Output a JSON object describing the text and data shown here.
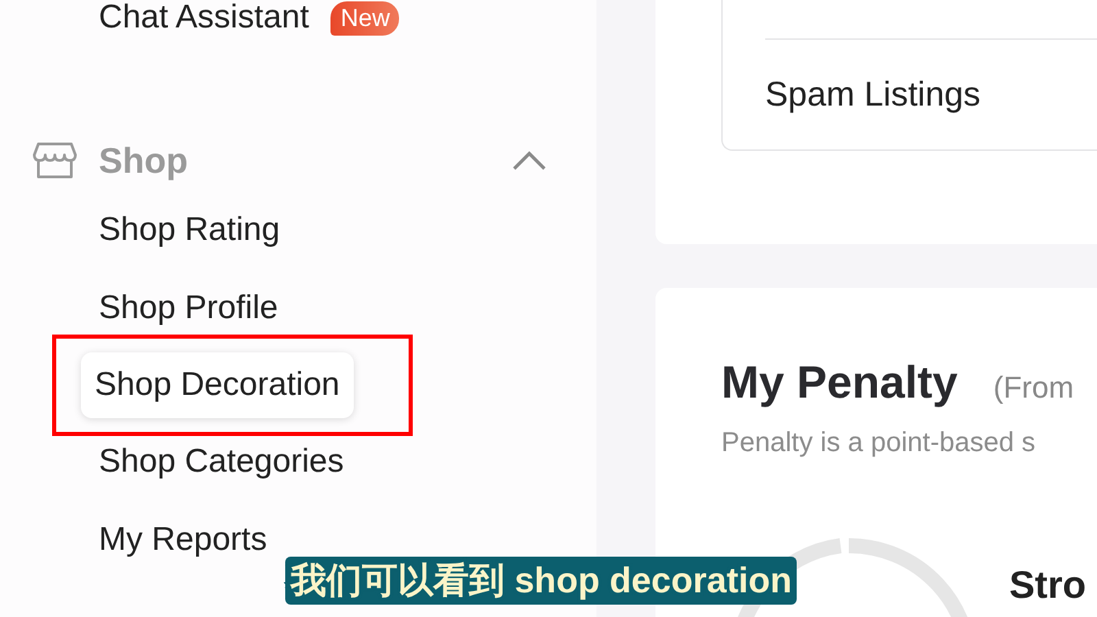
{
  "sidebar": {
    "top_item": {
      "label": "Chat Assistant",
      "badge": "New"
    },
    "group": {
      "label": "Shop",
      "expanded": true,
      "children": [
        {
          "label": "Shop Rating",
          "selected": false,
          "highlighted": false
        },
        {
          "label": "Shop Profile",
          "selected": false,
          "highlighted": false
        },
        {
          "label": "Shop Decoration",
          "selected": true,
          "highlighted": true
        },
        {
          "label": "Shop Categories",
          "selected": false,
          "highlighted": false
        },
        {
          "label": "My Reports",
          "selected": false,
          "highlighted": false
        }
      ]
    }
  },
  "main": {
    "report_card": {
      "items": [
        "Spam Listings"
      ]
    },
    "penalty_card": {
      "title": "My Penalty",
      "period": "(From",
      "description": "Penalty is a point-based s",
      "status": "Stro"
    }
  },
  "subtitle": "我们可以看到 shop decoration"
}
